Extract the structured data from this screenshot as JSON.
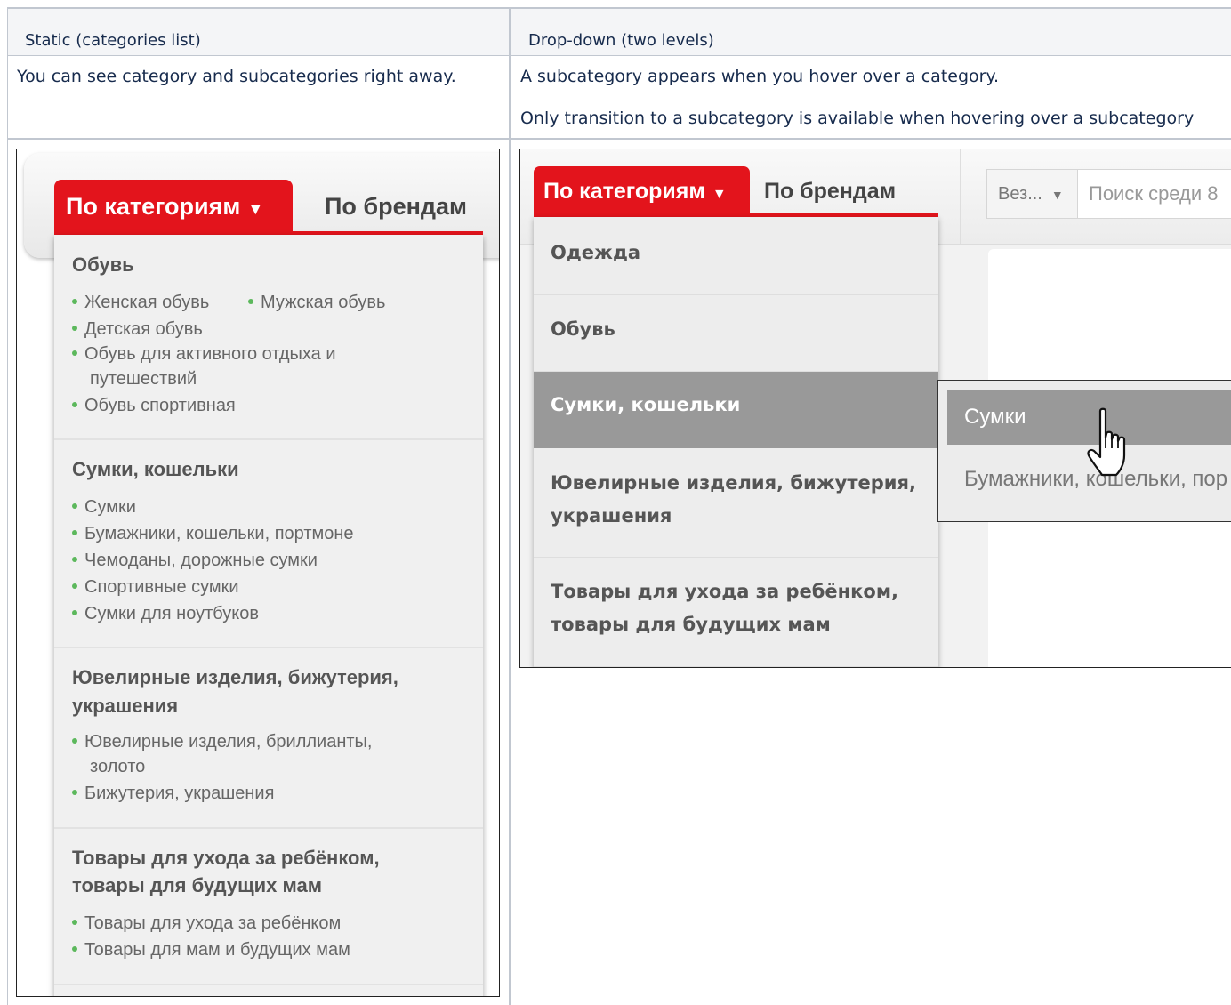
{
  "table": {
    "col1_header": "Static (categories list)",
    "col2_header": "Drop-down (two levels)",
    "col1_description": "You can see category and subcategories right away.",
    "col2_description_1": "A subcategory appears when you hover over a category.",
    "col2_description_2": "Only transition to a subcategory is available when hovering over a subcategory"
  },
  "static_menu": {
    "tab_categories": "По категориям",
    "tab_arrow": "▼",
    "tab_brands": "По брендам",
    "groups": [
      {
        "title_lines": [
          "Обувь"
        ],
        "items": [
          "Женская обувь",
          "Мужская обувь",
          "Детская обувь",
          "Обувь для активного отдыха и",
          "путешествий",
          "Обувь спортивная"
        ]
      },
      {
        "title_lines": [
          "Сумки, кошельки"
        ],
        "items": [
          "Сумки",
          "Бумажники, кошельки, портмоне",
          "Чемоданы, дорожные сумки",
          "Спортивные сумки",
          "Сумки для ноутбуков"
        ]
      },
      {
        "title_lines": [
          "Ювелирные изделия, бижутерия,",
          "украшения"
        ],
        "items": [
          "Ювелирные изделия, бриллианты,",
          "золото",
          "Бижутерия, украшения"
        ]
      },
      {
        "title_lines": [
          "Товары для ухода за ребёнком,",
          "товары для будущих мам"
        ],
        "items": [
          "Товары для ухода за ребёнком",
          "Товары для мам и будущих мам"
        ]
      }
    ]
  },
  "dropdown_menu": {
    "tab_categories": "По категориям",
    "tab_arrow": "▼",
    "tab_brands": "По брендам",
    "filter_select": "Вез...",
    "filter_arrow": "▼",
    "search_placeholder": "Поиск среди 8",
    "categories": [
      {
        "lines": [
          "Одежда"
        ],
        "active": false
      },
      {
        "lines": [
          "Обувь"
        ],
        "active": false
      },
      {
        "lines": [
          "Сумки, кошельки"
        ],
        "active": true
      },
      {
        "lines": [
          "Ювелирные изделия, бижутерия,",
          "украшения"
        ],
        "active": false
      },
      {
        "lines": [
          "Товары для ухода за ребёнком,",
          "товары для будущих мам"
        ],
        "active": false
      }
    ],
    "subcategories": [
      {
        "label": "Сумки",
        "active": true
      },
      {
        "label": "Бумажники, кошельки, пор",
        "active": false
      }
    ]
  },
  "colors": {
    "brand_red": "#e3141c",
    "bullet_green": "#5cb85c",
    "active_gray": "#999999",
    "table_header_bg": "#f4f5f7",
    "table_border": "#c1c7d0"
  }
}
